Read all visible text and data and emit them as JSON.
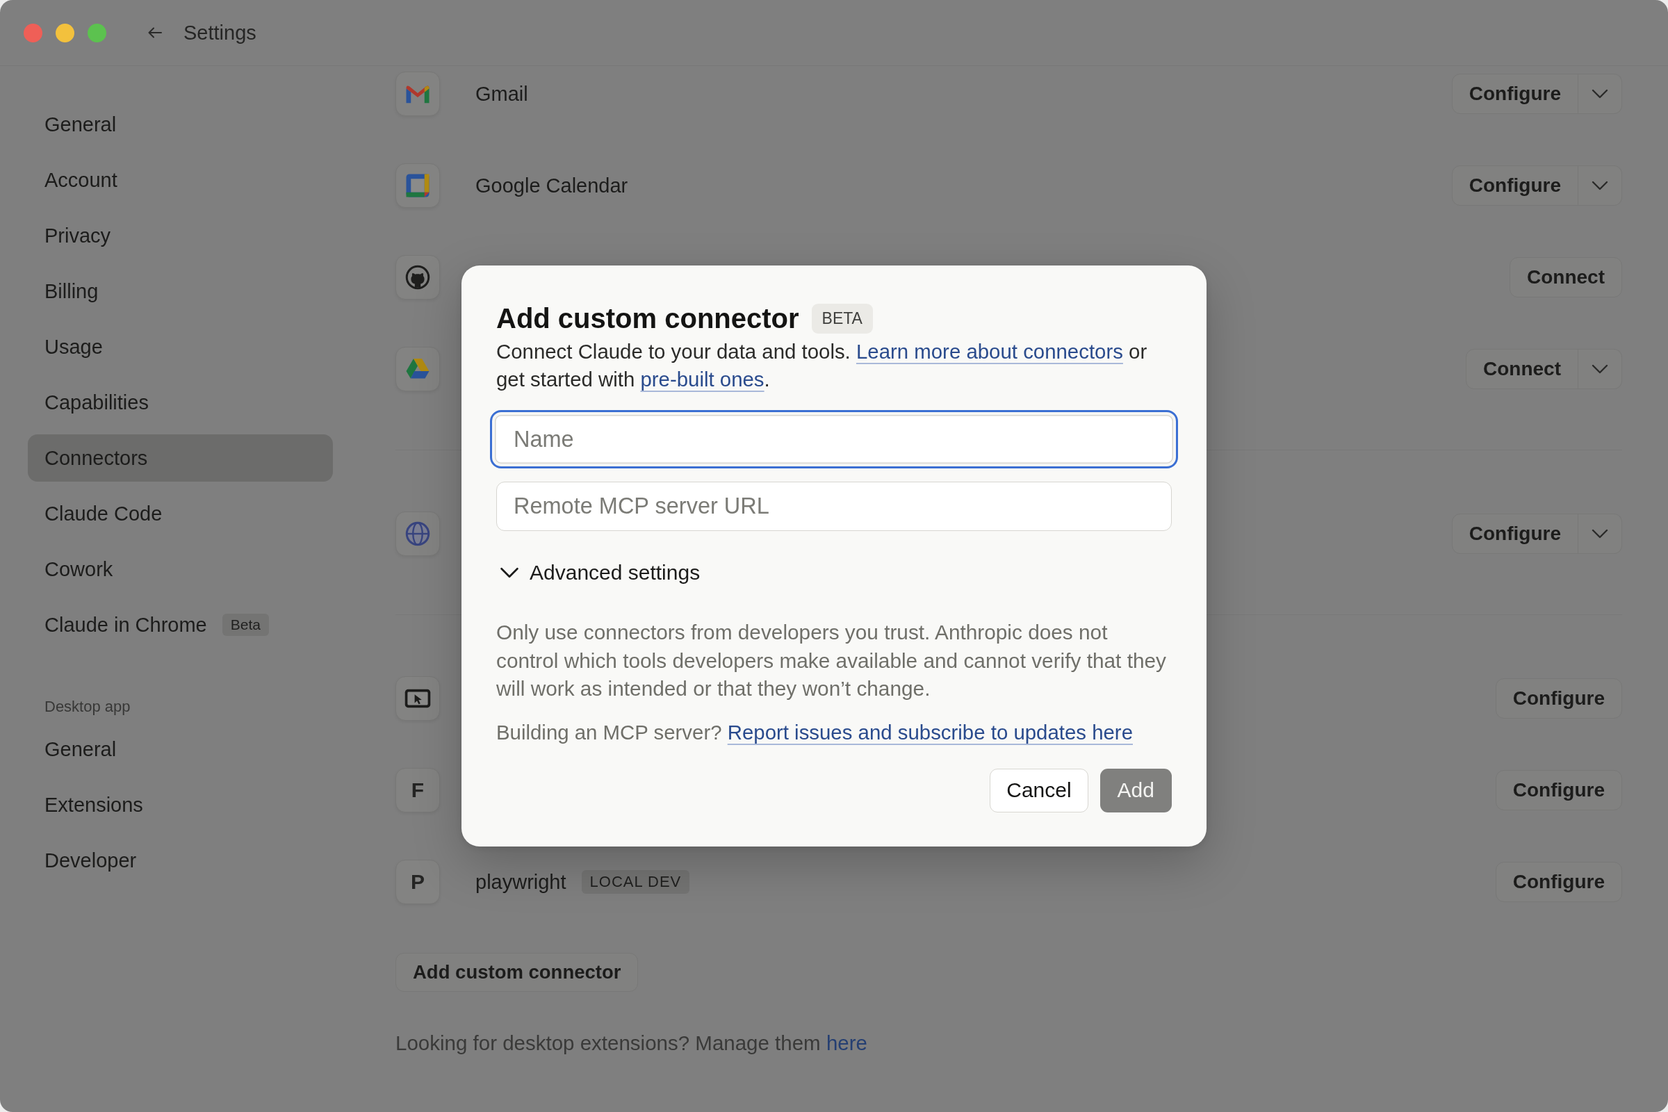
{
  "window": {
    "title": "Settings"
  },
  "sidebar": {
    "groups": [
      {
        "items": [
          {
            "label": "General",
            "selected": false
          },
          {
            "label": "Account",
            "selected": false
          },
          {
            "label": "Privacy",
            "selected": false
          },
          {
            "label": "Billing",
            "selected": false
          },
          {
            "label": "Usage",
            "selected": false
          },
          {
            "label": "Capabilities",
            "selected": false
          },
          {
            "label": "Connectors",
            "selected": true
          },
          {
            "label": "Claude Code",
            "selected": false
          },
          {
            "label": "Cowork",
            "selected": false
          },
          {
            "label": "Claude in Chrome",
            "badge": "Beta",
            "selected": false
          }
        ]
      },
      {
        "heading": "Desktop app",
        "items": [
          {
            "label": "General",
            "selected": false
          },
          {
            "label": "Extensions",
            "selected": false
          },
          {
            "label": "Developer",
            "selected": false
          }
        ]
      }
    ]
  },
  "connectors": {
    "sections": [
      {
        "rows": [
          {
            "kind": "mail",
            "name": "Gmail",
            "action": "Configure",
            "menu": true
          },
          {
            "kind": "calendar",
            "name": "Google Calendar",
            "action": "Configure",
            "menu": true
          },
          {
            "kind": "cat",
            "action": "Connect",
            "menu": false
          },
          {
            "kind": "triangle",
            "action": "Connect",
            "menu": true
          }
        ]
      },
      {
        "rows": [
          {
            "kind": "globe",
            "action": "Configure",
            "menu": true
          }
        ]
      },
      {
        "rows": [
          {
            "kind": "monitor",
            "action": "Configure",
            "menu": false
          },
          {
            "kind": "letter",
            "initial": "F",
            "action": "Configure",
            "menu": false
          },
          {
            "kind": "letter",
            "initial": "P",
            "name": "playwright",
            "badge": "LOCAL DEV",
            "action": "Configure",
            "menu": false
          }
        ]
      }
    ],
    "add_button": "Add custom connector",
    "footer": [
      {
        "kind": "text",
        "text": "Looking for desktop extensions? Manage them "
      },
      {
        "kind": "link",
        "text": "here"
      }
    ]
  },
  "dialog": {
    "title": "Add custom connector",
    "badge": "BETA",
    "intro": [
      {
        "kind": "text",
        "text": "Connect Claude to your data and tools. "
      },
      {
        "kind": "link",
        "text": "Learn more about connectors"
      },
      {
        "kind": "text",
        "text": " or get started with "
      },
      {
        "kind": "link",
        "text": "pre-built ones"
      },
      {
        "kind": "text",
        "text": "."
      }
    ],
    "fields": [
      {
        "placeholder": "Name",
        "focused": true
      },
      {
        "placeholder": "Remote MCP server URL",
        "focused": false
      }
    ],
    "advanced": {
      "label": "Advanced settings",
      "expanded": false
    },
    "warning": "Only use connectors from developers you trust. Anthropic does not control which tools developers make available and cannot verify that they will work as intended or that they won’t change.",
    "building": [
      {
        "kind": "text",
        "text": "Building an MCP server? "
      },
      {
        "kind": "link",
        "text": "Report issues and subscribe to updates here"
      }
    ],
    "buttons": [
      {
        "kind": "secondary",
        "label": "Cancel",
        "disabled": false
      },
      {
        "kind": "primary",
        "label": "Add",
        "disabled": true
      }
    ]
  }
}
